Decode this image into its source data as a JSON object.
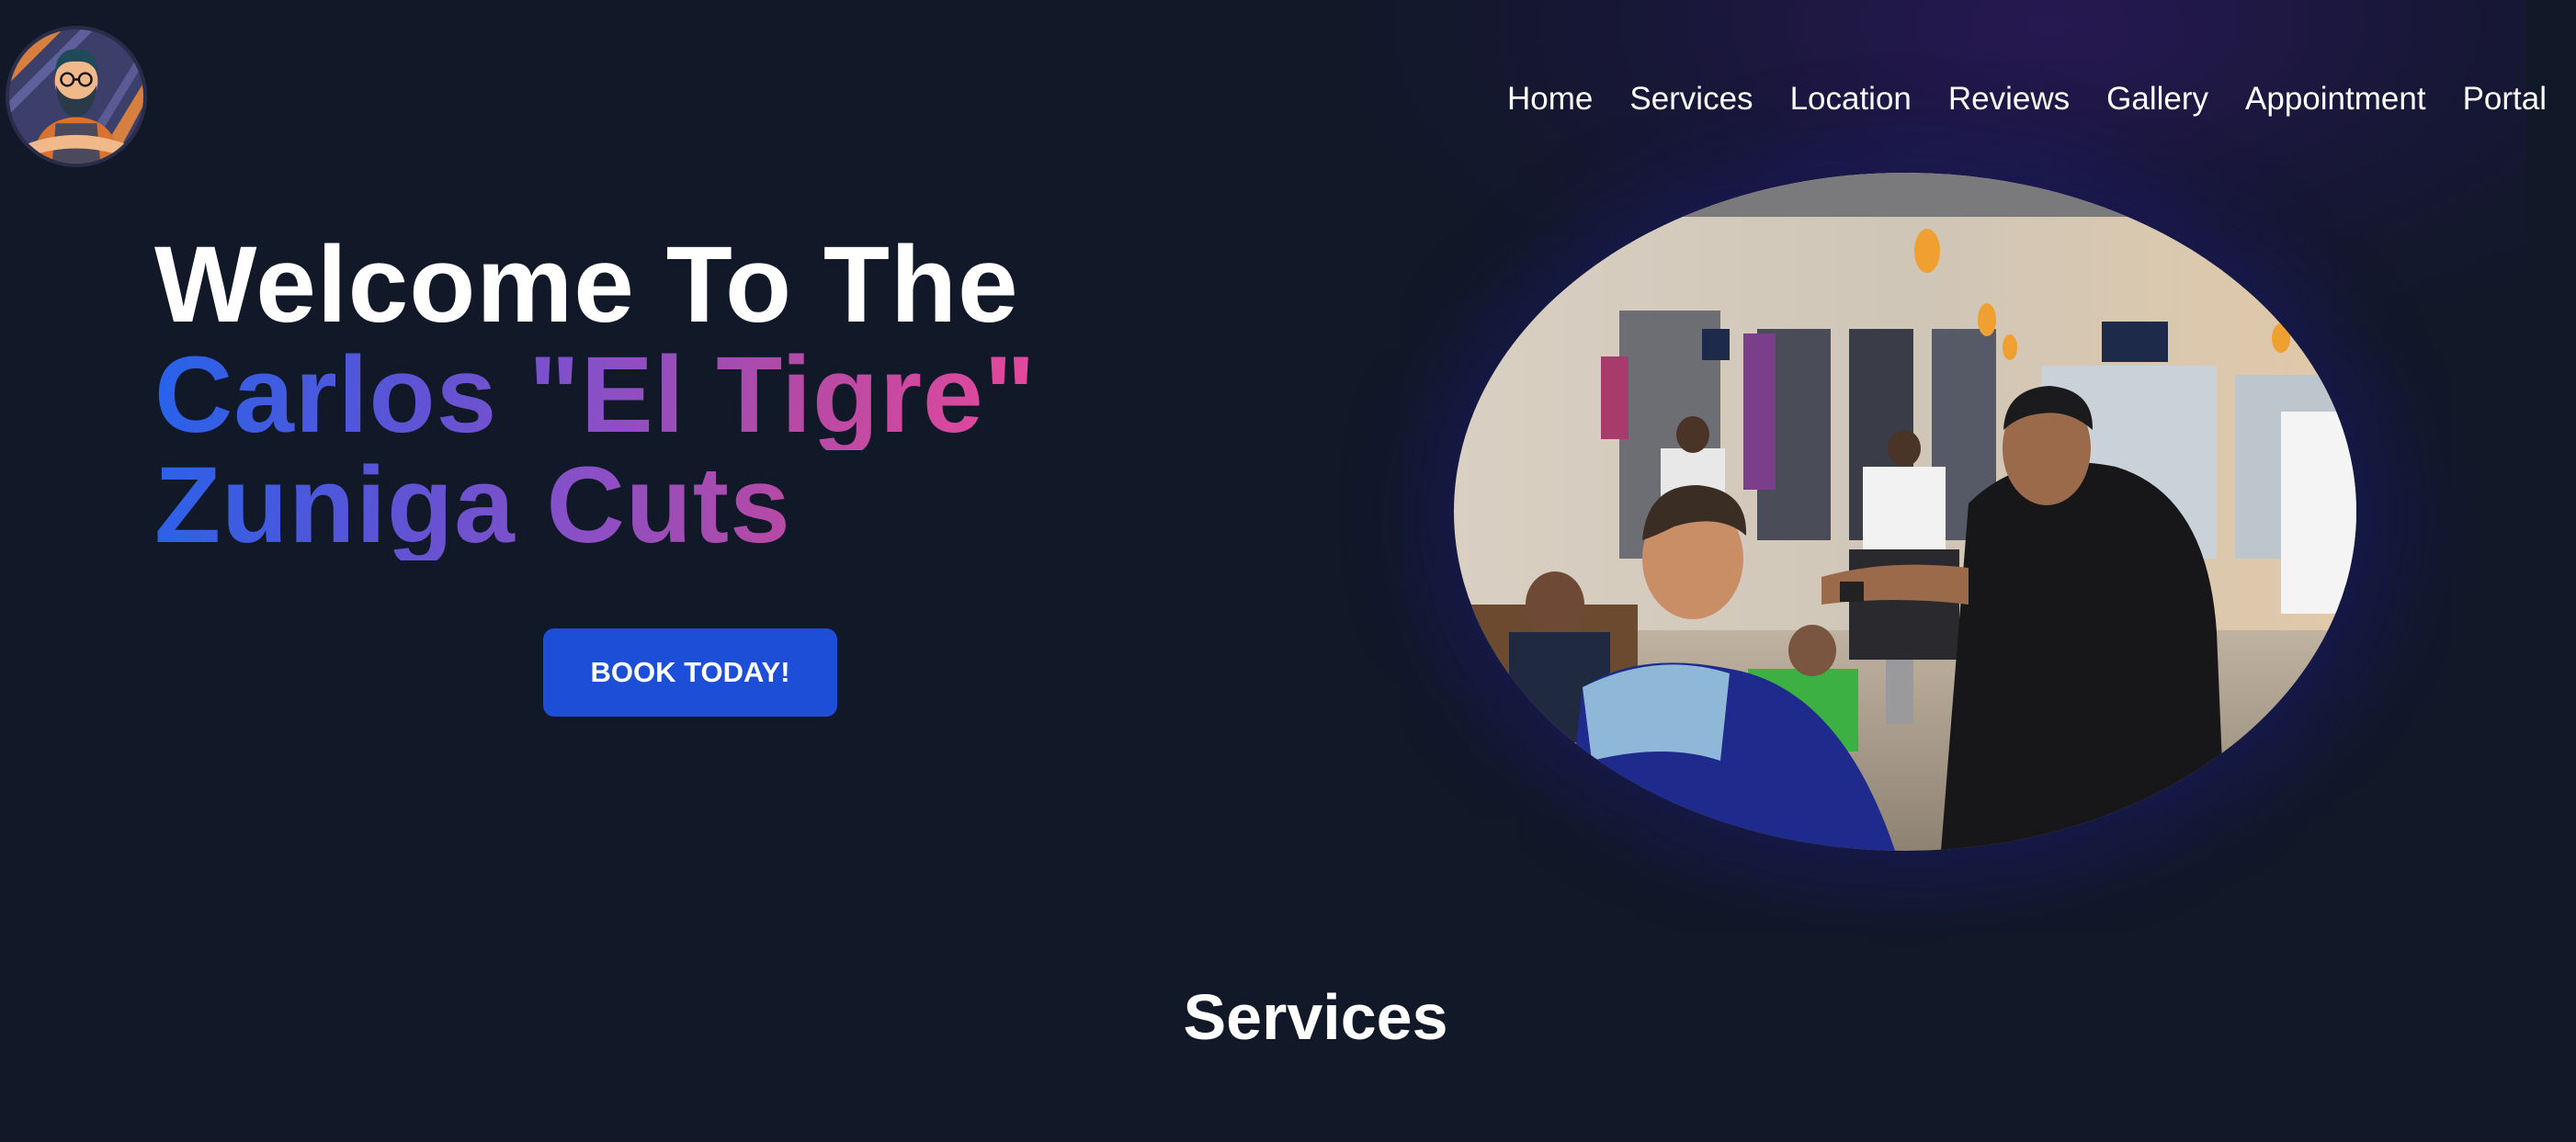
{
  "nav": {
    "items": [
      "Home",
      "Services",
      "Location",
      "Reviews",
      "Gallery",
      "Appointment",
      "Portal"
    ]
  },
  "hero": {
    "title_line1": "Welcome To The",
    "title_line2": "Carlos \"El Tigre\"",
    "title_line3": "Zuniga Cuts",
    "cta_label": "BOOK TODAY!"
  },
  "sections": {
    "services_heading": "Services"
  },
  "colors": {
    "background": "#111827",
    "button": "#1d4ed8",
    "gradient_start": "#2563eb",
    "gradient_end": "#ec4899"
  },
  "icons": {
    "logo": "barber-mascot-logo"
  }
}
